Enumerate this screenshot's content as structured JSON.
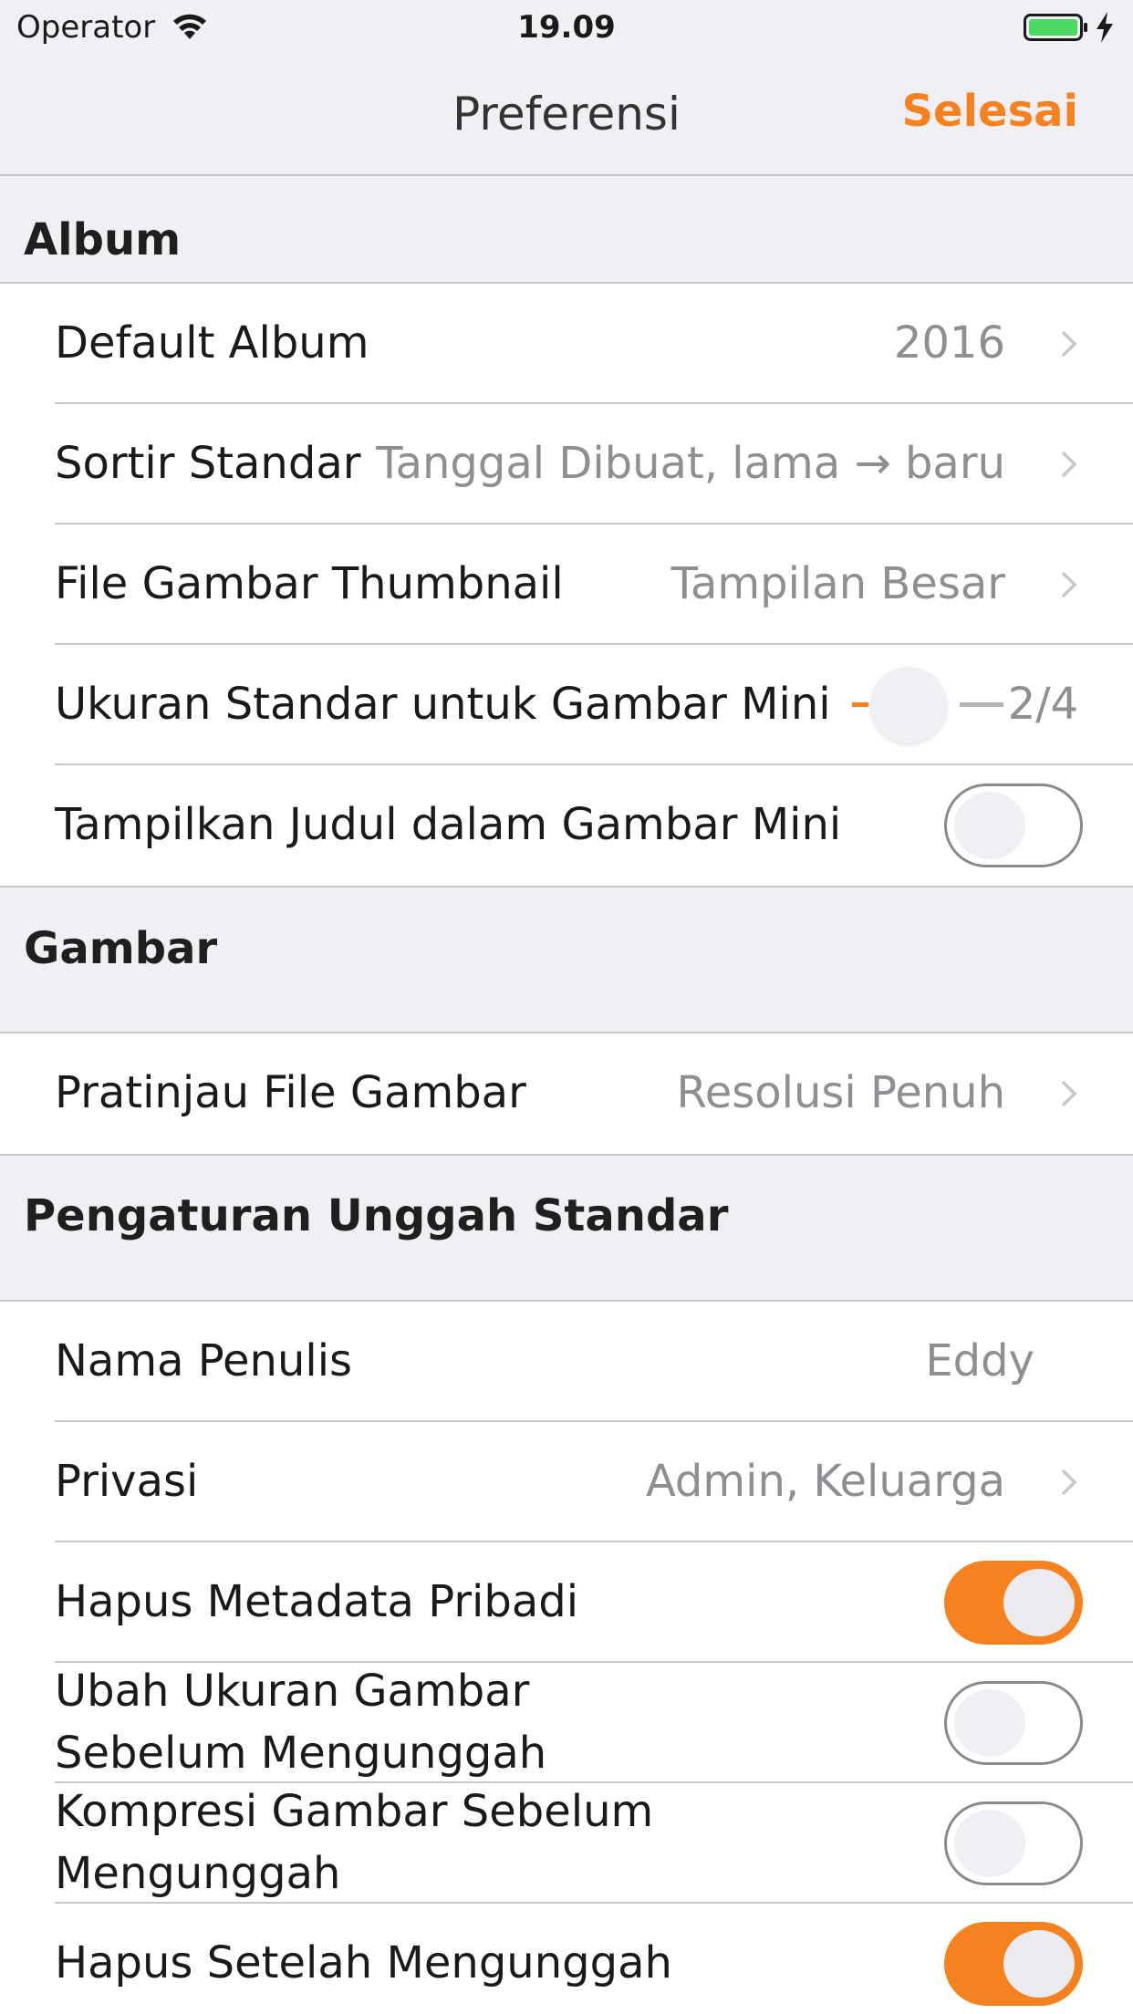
{
  "status_bar": {
    "carrier": "Operator",
    "time": "19.09",
    "battery_color": "#4cd964"
  },
  "nav": {
    "title": "Preferensi",
    "done_label": "Selesai",
    "accent_color": "#f5821f"
  },
  "sections": {
    "album": {
      "header": "Album",
      "default_album": {
        "label": "Default Album",
        "value": "2016"
      },
      "sort": {
        "label": "Sortir Standar",
        "value": "Tanggal Dibuat, lama → baru"
      },
      "thumbnail_file": {
        "label": "File Gambar Thumbnail",
        "value": "Tampilan Besar"
      },
      "thumbnail_size": {
        "label": "Ukuran Standar untuk Gambar Mini",
        "value": "2/4",
        "level": 0.25
      },
      "show_titles": {
        "label": "Tampilkan Judul dalam Gambar Mini",
        "on": false
      }
    },
    "images": {
      "header": "Gambar",
      "preview_file": {
        "label": "Pratinjau File Gambar",
        "value": "Resolusi Penuh"
      }
    },
    "upload": {
      "header": "Pengaturan Unggah Standar",
      "author": {
        "label": "Nama Penulis",
        "value": "Eddy"
      },
      "privacy": {
        "label": "Privasi",
        "value": "Admin, Keluarga"
      },
      "strip_metadata": {
        "label": "Hapus Metadata Pribadi",
        "on": true
      },
      "resize": {
        "label": "Ubah Ukuran Gambar Sebelum Mengunggah",
        "on": false
      },
      "compress": {
        "label": "Kompresi Gambar Sebelum Mengunggah",
        "on": false
      },
      "delete_after": {
        "label": "Hapus Setelah Mengunggah",
        "on": true
      }
    }
  },
  "icons": {
    "wifi": "wifi-icon",
    "battery": "battery-icon",
    "charging": "bolt-icon",
    "chevron": "chevron-right-icon"
  }
}
